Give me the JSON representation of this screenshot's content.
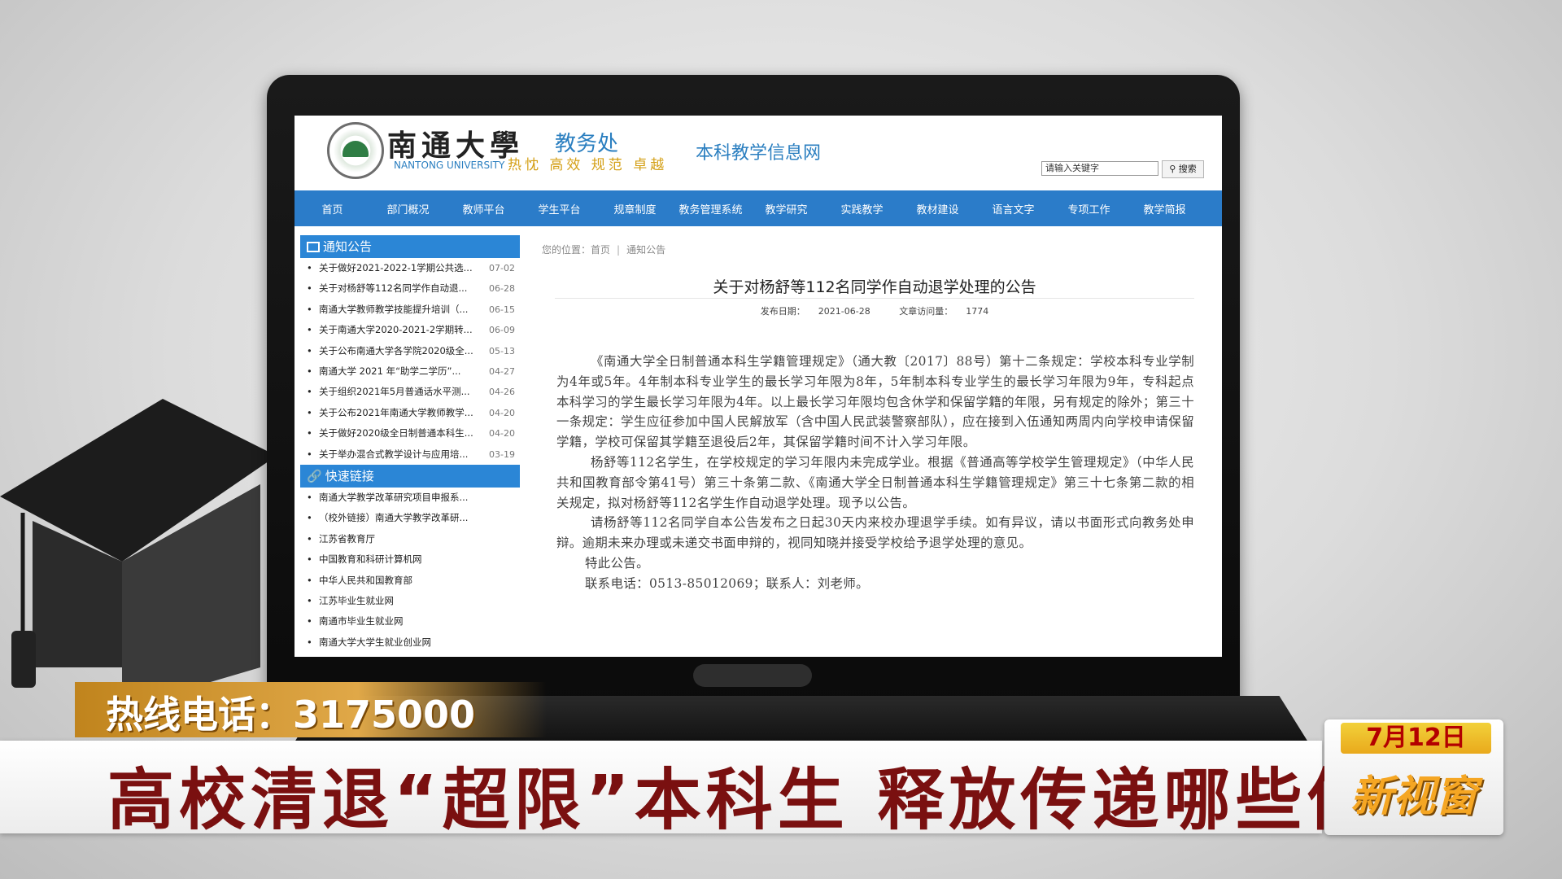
{
  "site": {
    "logo_cn": "南通大學",
    "logo_en": "NANTONG UNIVERSITY",
    "motto": "热忱 高效 规范 卓越",
    "office": "教务处",
    "site_name": "本科教学信息网",
    "search_placeholder": "请输入关键字",
    "search_button": "搜索"
  },
  "nav": [
    "首页",
    "部门概况",
    "教师平台",
    "学生平台",
    "规章制度",
    "教务管理系统",
    "教学研究",
    "实践教学",
    "教材建设",
    "语言文字",
    "专项工作",
    "教学简报"
  ],
  "sidebar": {
    "notices_title": "通知公告",
    "notices": [
      {
        "title": "关于做好2021-2022-1学期公共选...",
        "date": "07-02"
      },
      {
        "title": "关于对杨舒等112名同学作自动退...",
        "date": "06-28"
      },
      {
        "title": "南通大学教师教学技能提升培训（...",
        "date": "06-15"
      },
      {
        "title": "关于南通大学2020-2021-2学期转...",
        "date": "06-09"
      },
      {
        "title": "关于公布南通大学各学院2020级全...",
        "date": "05-13"
      },
      {
        "title": "南通大学 2021 年“助学二学历”...",
        "date": "04-27"
      },
      {
        "title": "关于组织2021年5月普通话水平测...",
        "date": "04-26"
      },
      {
        "title": "关于公布2021年南通大学教师教学...",
        "date": "04-20"
      },
      {
        "title": "关于做好2020级全日制普通本科生...",
        "date": "04-20"
      },
      {
        "title": "关于举办混合式教学设计与应用培...",
        "date": "03-19"
      }
    ],
    "links_title": "快速链接",
    "links": [
      "南通大学教学改革研究项目申报系...",
      "（校外链接）南通大学教学改革研...",
      "江苏省教育厅",
      "中国教育和科研计算机网",
      "中华人民共和国教育部",
      "江苏毕业生就业网",
      "南通市毕业生就业网",
      "南通大学大学生就业创业网"
    ]
  },
  "breadcrumb": {
    "label": "您的位置：",
    "home": "首页",
    "current": "通知公告"
  },
  "article": {
    "title": "关于对杨舒等112名同学作自动退学处理的公告",
    "publish_label": "发布日期：",
    "publish_date": "2021-06-28",
    "views_label": "文章访问量：",
    "views": "1774",
    "paragraphs": [
      "《南通大学全日制普通本科生学籍管理规定》（通大教〔2017〕88号）第十二条规定：学校本科专业学制为4年或5年。4年制本科专业学生的最长学习年限为8年，5年制本科专业学生的最长学习年限为9年，专科起点本科学习的学生最长学习年限为4年。以上最长学习年限均包含休学和保留学籍的年限，另有规定的除外；第三十一条规定：学生应征参加中国人民解放军（含中国人民武装警察部队），应在接到入伍通知两周内向学校申请保留学籍，学校可保留其学籍至退役后2年，其保留学籍时间不计入学习年限。",
      "杨舒等112名学生，在学校规定的学习年限内未完成学业。根据《普通高等学校学生管理规定》（中华人民共和国教育部令第41号）第三十条第二款、《南通大学全日制普通本科生学籍管理规定》第三十七条第二款的相关规定，拟对杨舒等112名学生作自动退学处理。现予以公告。",
      "请杨舒等112名同学自本公告发布之日起30天内来校办理退学手续。如有异议，请以书面形式向教务处申辩。逾期未来办理或未递交书面申辩的，视同知晓并接受学校给予退学处理的意见。",
      "特此公告。",
      "联系电话：0513-85012069；联系人：刘老师。"
    ]
  },
  "tv": {
    "hotline": "热线电话：3175000",
    "headline": "高校清退“超限”本科生 释放传递哪些信号",
    "date": "7月12日",
    "brand": "新视窗"
  },
  "colors": {
    "nav_blue": "#2b7cc9",
    "sidebar_blue": "#2b86d6",
    "headline_red": "#7a1010",
    "hotline_orange": "#d9992f"
  }
}
